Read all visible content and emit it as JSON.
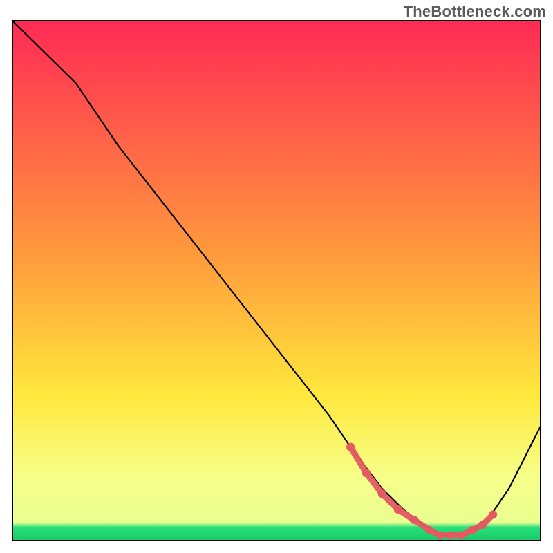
{
  "watermark": "TheBottleneck.com",
  "chart_data": {
    "type": "line",
    "title": "",
    "xlabel": "",
    "ylabel": "",
    "x_range": [
      0,
      100
    ],
    "y_range": [
      0,
      100
    ],
    "grid": false,
    "legend": false,
    "background_gradient": {
      "stops": [
        {
          "offset": 0.0,
          "color": "#ff2a55"
        },
        {
          "offset": 0.45,
          "color": "#ff9a3c"
        },
        {
          "offset": 0.72,
          "color": "#ffe83c"
        },
        {
          "offset": 0.88,
          "color": "#f6ff8a"
        },
        {
          "offset": 0.965,
          "color": "#eaff8f"
        },
        {
          "offset": 0.975,
          "color": "#25e07a"
        },
        {
          "offset": 1.0,
          "color": "#18c968"
        }
      ]
    },
    "series": [
      {
        "name": "bottleneck-curve",
        "x": [
          0,
          3,
          8,
          12,
          20,
          30,
          40,
          50,
          60,
          64,
          70,
          74,
          79,
          82,
          86,
          90,
          94,
          100
        ],
        "y": [
          100,
          97,
          92,
          88,
          76,
          63,
          50,
          37,
          24,
          18,
          10,
          6,
          2,
          1,
          1,
          4,
          10,
          22
        ],
        "stroke": "#000000",
        "stroke_width": 2.2
      }
    ],
    "highlight_segment": {
      "series": "bottleneck-curve",
      "x": [
        64,
        67,
        70,
        73,
        76,
        79,
        81,
        83,
        85,
        87,
        89,
        91
      ],
      "y": [
        18,
        13,
        9,
        6,
        4,
        2,
        1,
        1,
        1,
        2,
        3,
        5
      ],
      "stroke": "#e45a63",
      "stroke_width": 9,
      "dot_radius": 6
    },
    "frame": {
      "inset": 18,
      "stroke": "#000000",
      "stroke_width": 2
    }
  }
}
